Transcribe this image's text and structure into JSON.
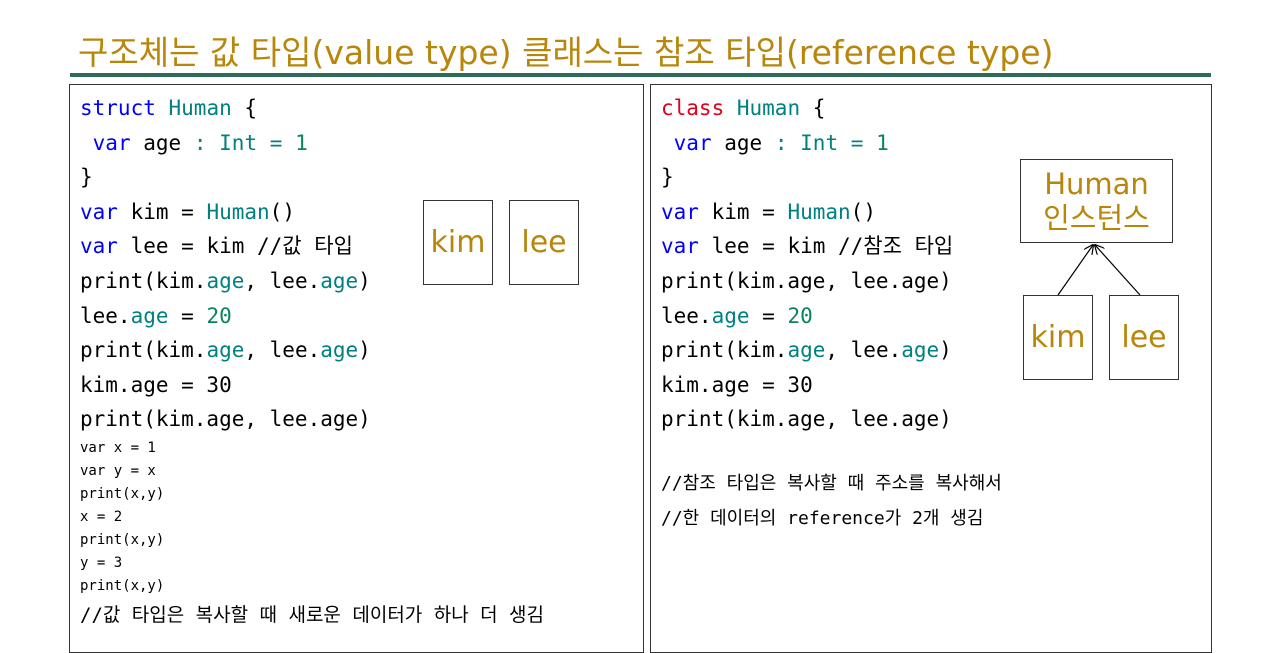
{
  "title": "구조체는 값 타입(value type) 클래스는 참조 타입(reference type)",
  "colors": {
    "title": "#b8860b",
    "rule": "#2e6b5a",
    "keyword": "#0000ff",
    "class_keyword": "#e0001a",
    "type": "#008080",
    "number": "#098658"
  },
  "left": {
    "l1": {
      "kw": "struct",
      "name": "Human",
      "brace": "{"
    },
    "l2": {
      "kw": "var",
      "ident": "age",
      "colon": ":",
      "type": "Int",
      "eq": "=",
      "num": "1"
    },
    "l3": "}",
    "l4": {
      "kw": "var",
      "rest": "kim = ",
      "call": "Human",
      "paren": "()"
    },
    "l5": {
      "kw": "var",
      "rest": "lee = kim //값 타입"
    },
    "l6": {
      "a": "print(kim.",
      "b": "age",
      "c": ", lee.",
      "d": "age",
      "e": ")"
    },
    "l7": {
      "a": "lee.",
      "b": "age",
      "c": " = ",
      "d": "20"
    },
    "l8": {
      "a": "print(kim.",
      "b": "age",
      "c": ", lee.",
      "d": "age",
      "e": ")"
    },
    "l9": "kim.age = 30",
    "l10": "print(kim.age, lee.age)",
    "small": [
      "var x = 1",
      "var y = x",
      "print(x,y)",
      "x = 2",
      "print(x,y)",
      "y = 3",
      "print(x,y)"
    ],
    "comment": "//값 타입은 복사할 때 새로운 데이터가 하나 더 생김",
    "box_kim": "kim",
    "box_lee": "lee"
  },
  "right": {
    "l1": {
      "kw": "class",
      "name": "Human",
      "brace": "{"
    },
    "l2": {
      "kw": "var",
      "ident": "age",
      "colon": ":",
      "type": "Int",
      "eq": "=",
      "num": "1"
    },
    "l3": "}",
    "l4": {
      "kw": "var",
      "rest": "kim = ",
      "call": "Human",
      "paren": "()"
    },
    "l5": {
      "kw": "var",
      "rest": "lee = kim //참조 타입"
    },
    "l6": "print(kim.age, lee.age)",
    "l7": {
      "a": "lee.",
      "b": "age",
      "c": " = ",
      "d": "20"
    },
    "l8": {
      "a": "print(kim.",
      "b": "age",
      "c": ", lee.",
      "d": "age",
      "e": ")"
    },
    "l9": "kim.age = 30",
    "l10": "print(kim.age, lee.age)",
    "comment1": "//참조 타입은 복사할 때 주소를 복사해서",
    "comment2": "//한 데이터의 reference가 2개 생김",
    "instance_box": {
      "line1": "Human",
      "line2": "인스턴스"
    },
    "box_kim": "kim",
    "box_lee": "lee"
  }
}
